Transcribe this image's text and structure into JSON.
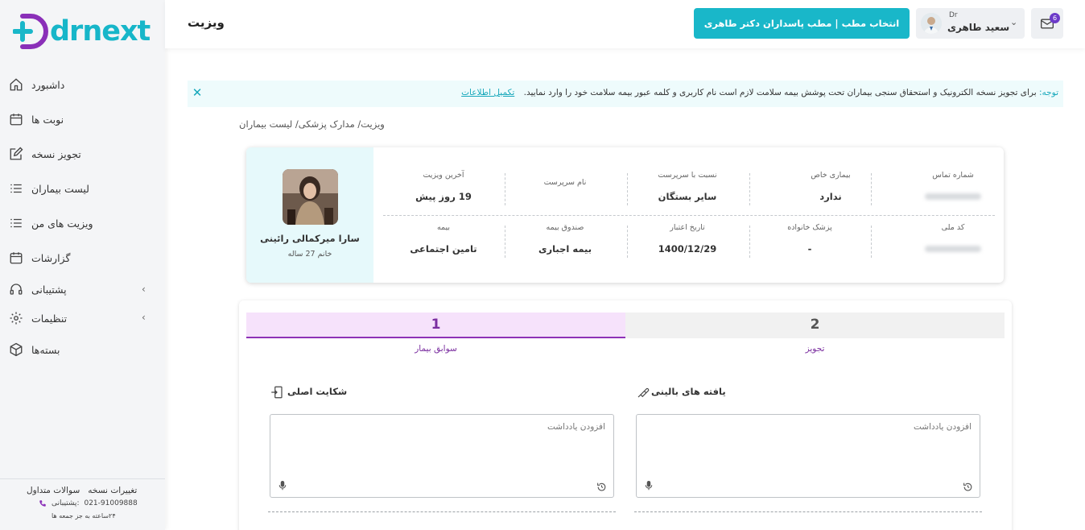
{
  "brand": {
    "logo_text": "drnext"
  },
  "header": {
    "page_title": "ویزیت",
    "office_button": "انتخاب مطب | مطب پاسداران دکتر طاهری",
    "user": {
      "prefix": "Dr",
      "name": "سعید طاهری"
    },
    "mail_badge": "6"
  },
  "sidebar": {
    "items": [
      {
        "label": "داشبورد",
        "icon": "home-icon"
      },
      {
        "label": "نوبت ها",
        "icon": "calendar-icon"
      },
      {
        "label": "تجویز نسخه",
        "icon": "edit-icon"
      },
      {
        "label": "لیست بیماران",
        "icon": "list-icon"
      },
      {
        "label": "ویزیت های من",
        "icon": "list-icon"
      },
      {
        "label": "گزارشات",
        "icon": "calendar-icon"
      },
      {
        "label": "پشتیبانی",
        "icon": "headset-icon"
      },
      {
        "label": "تنظیمات",
        "icon": "gear-icon"
      },
      {
        "label": "بسته‌ها",
        "icon": "box-icon"
      }
    ],
    "footer": {
      "faq": "سوالات متداول",
      "changes": "تغییرات نسخه",
      "support_label": "پشتیبانی:",
      "phone": "021-91009888",
      "hours": "۲۴ساعته به جز جمعه ها"
    }
  },
  "notice": {
    "label": "توجه:",
    "text": "برای تجویز نسخه الکترونیک و استحقاق سنجی بیماران تحت پوشش بیمه سلامت لازم است نام کاربری و کلمه عبور بیمه سلامت خود را وارد نمایید.",
    "link": "تکمیل اطلاعات"
  },
  "breadcrumb": "ویزیت/ مدارک پزشکی/ لیست بیماران",
  "patient": {
    "name": "سارا میرکمالی رائینی",
    "subtitle": "خانم 27 ساله",
    "fields_row1": [
      {
        "key": "شماره تماس",
        "value": ""
      },
      {
        "key": "بیماری خاص",
        "value": "ندارد"
      },
      {
        "key": "نسبت با سرپرست",
        "value": "سایر بستگان"
      },
      {
        "key": "نام سرپرست",
        "value": ""
      },
      {
        "key": "آخرین ویزیت",
        "value": "19 روز پیش"
      }
    ],
    "fields_row2": [
      {
        "key": "کد ملی",
        "value": ""
      },
      {
        "key": "پزشک خانواده",
        "value": "-"
      },
      {
        "key": "تاریخ اعتبار",
        "value": "1400/12/29"
      },
      {
        "key": "صندوق بیمه",
        "value": "بیمه اجباری"
      },
      {
        "key": "بیمه",
        "value": "تامین اجتماعی"
      }
    ]
  },
  "steps": [
    {
      "number": "1",
      "label": "سوابق بیمار",
      "active": true
    },
    {
      "number": "2",
      "label": "تجویز",
      "active": false
    }
  ],
  "sections": {
    "chief_complaint": {
      "title": "شکایت اصلی",
      "placeholder": "افزودن یادداشت"
    },
    "clinical_findings": {
      "title": "یافته های بالینی",
      "placeholder": "افزودن یادداشت"
    }
  },
  "colors": {
    "accent": "#19b7c9",
    "purple": "#7b2fa0",
    "sidebar_bg": "#f4f5f7"
  }
}
